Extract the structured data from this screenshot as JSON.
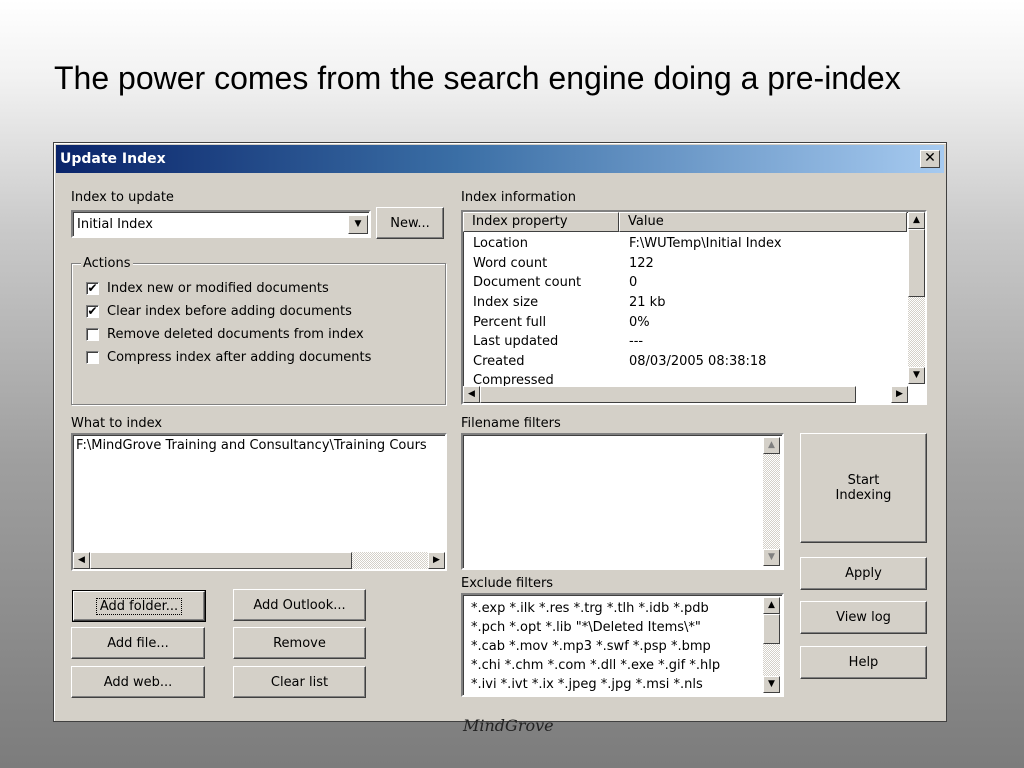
{
  "slide": {
    "title": "The power comes from the search engine doing a pre-index",
    "watermark": "MindGrove"
  },
  "dialog": {
    "title": "Update Index",
    "close_glyph": "✕",
    "index_to_update": {
      "label": "Index to update",
      "value": "Initial Index",
      "new_button": "New..."
    },
    "actions": {
      "legend": "Actions",
      "items": [
        {
          "label": "Index new or modified documents",
          "checked": true
        },
        {
          "label": "Clear index before adding documents",
          "checked": true
        },
        {
          "label": "Remove deleted documents from index",
          "checked": false
        },
        {
          "label": "Compress index after adding documents",
          "checked": false
        }
      ]
    },
    "index_information": {
      "label": "Index information",
      "columns": [
        "Index property",
        "Value"
      ],
      "rows": [
        {
          "property": "Location",
          "value": "F:\\WUTemp\\Initial Index"
        },
        {
          "property": "Word count",
          "value": "122"
        },
        {
          "property": "Document count",
          "value": "0"
        },
        {
          "property": "Index size",
          "value": "21 kb"
        },
        {
          "property": "Percent full",
          "value": "0%"
        },
        {
          "property": "Last updated",
          "value": "---"
        },
        {
          "property": "Created",
          "value": "08/03/2005 08:38:18"
        },
        {
          "property": "Compressed",
          "value": ""
        }
      ]
    },
    "what_to_index": {
      "label": "What to index",
      "items": [
        "F:\\MindGrove Training and Consultancy\\Training Cours"
      ]
    },
    "filename_filters": {
      "label": "Filename filters",
      "text": ""
    },
    "exclude_filters": {
      "label": "Exclude filters",
      "lines": [
        "*.exp *.ilk *.res *.trg *.tlh *.idb *.pdb",
        "*.pch *.opt *.lib \"*\\Deleted Items\\*\"",
        "*.cab *.mov *.mp3 *.swf *.psp *.bmp",
        "*.chi *.chm *.com *.dll *.exe *.gif *.hlp",
        "*.ivi *.ivt *.ix *.jpeg *.jpg *.msi *.nls"
      ]
    },
    "buttons": {
      "add_folder": "Add folder...",
      "add_outlook": "Add Outlook...",
      "add_file": "Add file...",
      "remove": "Remove",
      "add_web": "Add web...",
      "clear_list": "Clear list",
      "start_line1": "Start",
      "start_line2": "Indexing",
      "apply": "Apply",
      "view_log": "View log",
      "help": "Help"
    }
  }
}
